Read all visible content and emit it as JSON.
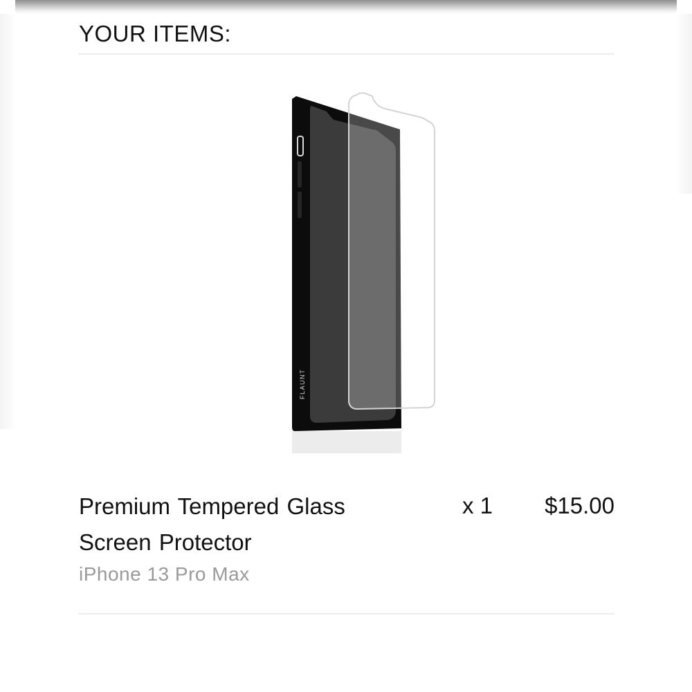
{
  "section": {
    "title": "YOUR ITEMS:"
  },
  "item": {
    "name": "Premium Tempered Glass Screen Protector",
    "variant": "iPhone 13 Pro Max",
    "quantity": "x 1",
    "price": "$15.00",
    "image_brand_text": "FLAUNT"
  },
  "colors": {
    "text": "#111111",
    "muted": "#9a9a9a",
    "divider": "#ececec"
  }
}
